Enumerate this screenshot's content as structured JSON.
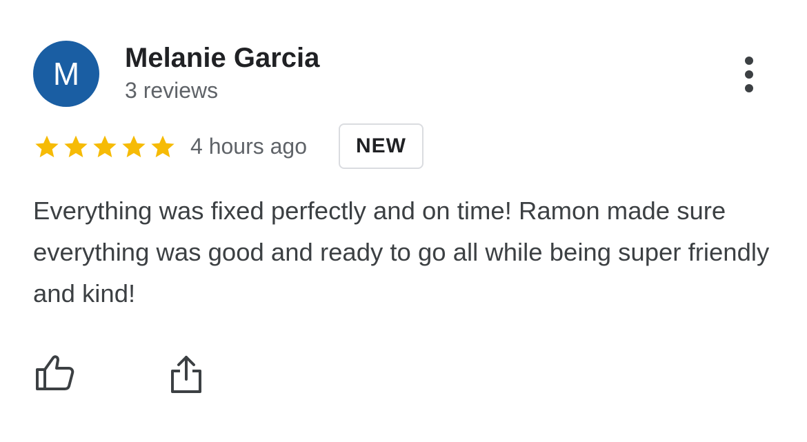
{
  "reviewer": {
    "avatar_letter": "M",
    "avatar_color": "#1a5ea3",
    "name": "Melanie Garcia",
    "review_count": "3 reviews"
  },
  "rating": {
    "stars": 5,
    "max_stars": 5,
    "star_color": "#f6bb06"
  },
  "meta": {
    "time_ago": "4 hours ago",
    "badge": "NEW"
  },
  "review": {
    "text": "Everything was fixed perfectly and on time! Ramon made sure everything was good and ready to go all while being super friendly and kind!"
  },
  "actions": {
    "more_icon": "more-vertical-icon",
    "like_icon": "thumbs-up-icon",
    "share_icon": "share-icon"
  }
}
